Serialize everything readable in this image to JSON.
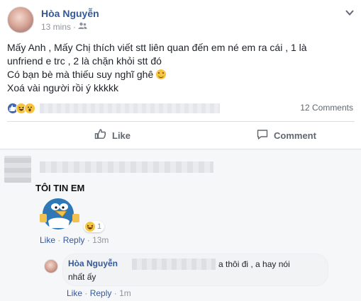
{
  "post": {
    "author": "Hòa Nguyễn",
    "time": "13 mins",
    "audience_icon": "friends-icon",
    "text_lines": [
      "Mấy Anh , Mấy Chị thích viết stt liên quan đến em né em ra cái , 1 là",
      "unfriend e trc , 2 là chặn khỏi stt đó",
      "Có bạn bè mà thiếu suy nghĩ ghê",
      "Xoá vài người rồi ý kkkkk"
    ]
  },
  "reactions": {
    "icons": [
      "like-reaction-icon",
      "haha-reaction-icon",
      "wow-reaction-icon"
    ],
    "comments_count": "12 Comments"
  },
  "actions": {
    "like_label": "Like",
    "comment_label": "Comment"
  },
  "comment1": {
    "sticker_text": "TÔI TIN EM",
    "reaction_count": "1",
    "like_label": "Like",
    "reply_label": "Reply",
    "time": "13m"
  },
  "reply1": {
    "author": "Hòa Nguyễn",
    "text_part1": "a thôi đi , a hay nói",
    "text_part2": "nhất ấy",
    "like_label": "Like",
    "reply_label": "Reply",
    "time": "1m"
  },
  "colors": {
    "link_blue": "#365899",
    "facebook_blue": "#4267b2",
    "muted": "#90949c"
  }
}
